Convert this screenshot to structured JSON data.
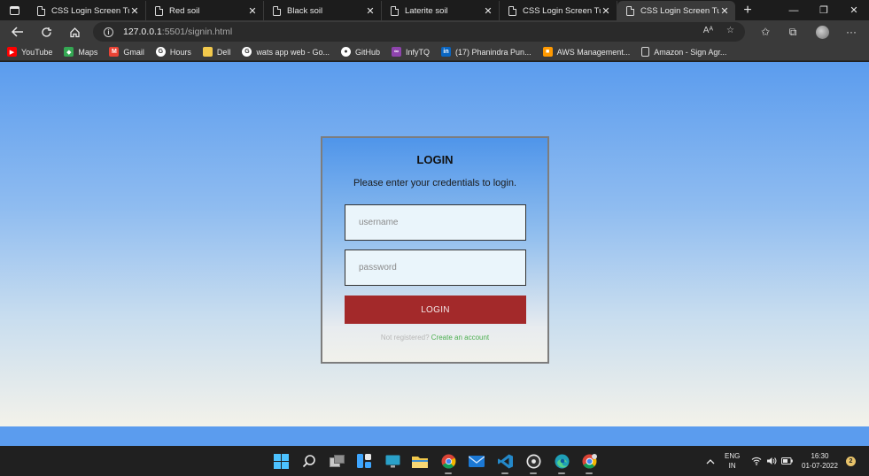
{
  "browser": {
    "tabs": [
      {
        "title": "CSS Login Screen Tuto",
        "active": false
      },
      {
        "title": "Red soil",
        "active": false
      },
      {
        "title": "Black soil",
        "active": false
      },
      {
        "title": "Laterite soil",
        "active": false
      },
      {
        "title": "CSS Login Screen Tuto",
        "active": false
      },
      {
        "title": "CSS Login Screen Tuto",
        "active": true
      }
    ],
    "new_tab": "+",
    "tab_close": "✕",
    "address": {
      "host": "127.0.0.1",
      "path": ":5501/signin.html"
    },
    "read_aloud": "Aᴬ",
    "bookmarks": [
      {
        "label": "YouTube",
        "icon": "youtube-icon",
        "color": "#ff0000",
        "glyph": "▶"
      },
      {
        "label": "Maps",
        "icon": "maps-icon",
        "color": "#34a853",
        "glyph": "◆"
      },
      {
        "label": "Gmail",
        "icon": "gmail-icon",
        "color": "#ea4335",
        "glyph": "M"
      },
      {
        "label": "Hours",
        "icon": "google-icon",
        "color": "#ffffff",
        "glyph": "G"
      },
      {
        "label": "Dell",
        "icon": "folder-icon",
        "color": "#f2c94c",
        "glyph": ""
      },
      {
        "label": "wats app web - Go...",
        "icon": "google-icon",
        "color": "#ffffff",
        "glyph": "G"
      },
      {
        "label": "GitHub",
        "icon": "github-icon",
        "color": "#ffffff",
        "glyph": "●"
      },
      {
        "label": "InfyTQ",
        "icon": "infytq-icon",
        "color": "#8e44ad",
        "glyph": "∞"
      },
      {
        "label": "(17) Phanindra Pun...",
        "icon": "linkedin-icon",
        "color": "#0a66c2",
        "glyph": "in"
      },
      {
        "label": "AWS Management...",
        "icon": "aws-icon",
        "color": "#f90",
        "glyph": "■"
      },
      {
        "label": "Amazon - Sign Agr...",
        "icon": "page-icon",
        "color": "#3a3a3a",
        "glyph": ""
      }
    ]
  },
  "login": {
    "title": "LOGIN",
    "subtitle": "Please enter your credentials to login.",
    "username_placeholder": "username",
    "password_placeholder": "password",
    "button_label": "login",
    "register_prompt": "Not registered?",
    "register_link": "Create an account"
  },
  "system": {
    "lang_line1": "ENG",
    "lang_line2": "IN",
    "time": "16:30",
    "date": "01-07-2022",
    "notification_count": "2"
  },
  "colors": {
    "accent_button": "#a3292a",
    "link": "#4caf50",
    "page_top": "#5b9cee"
  }
}
